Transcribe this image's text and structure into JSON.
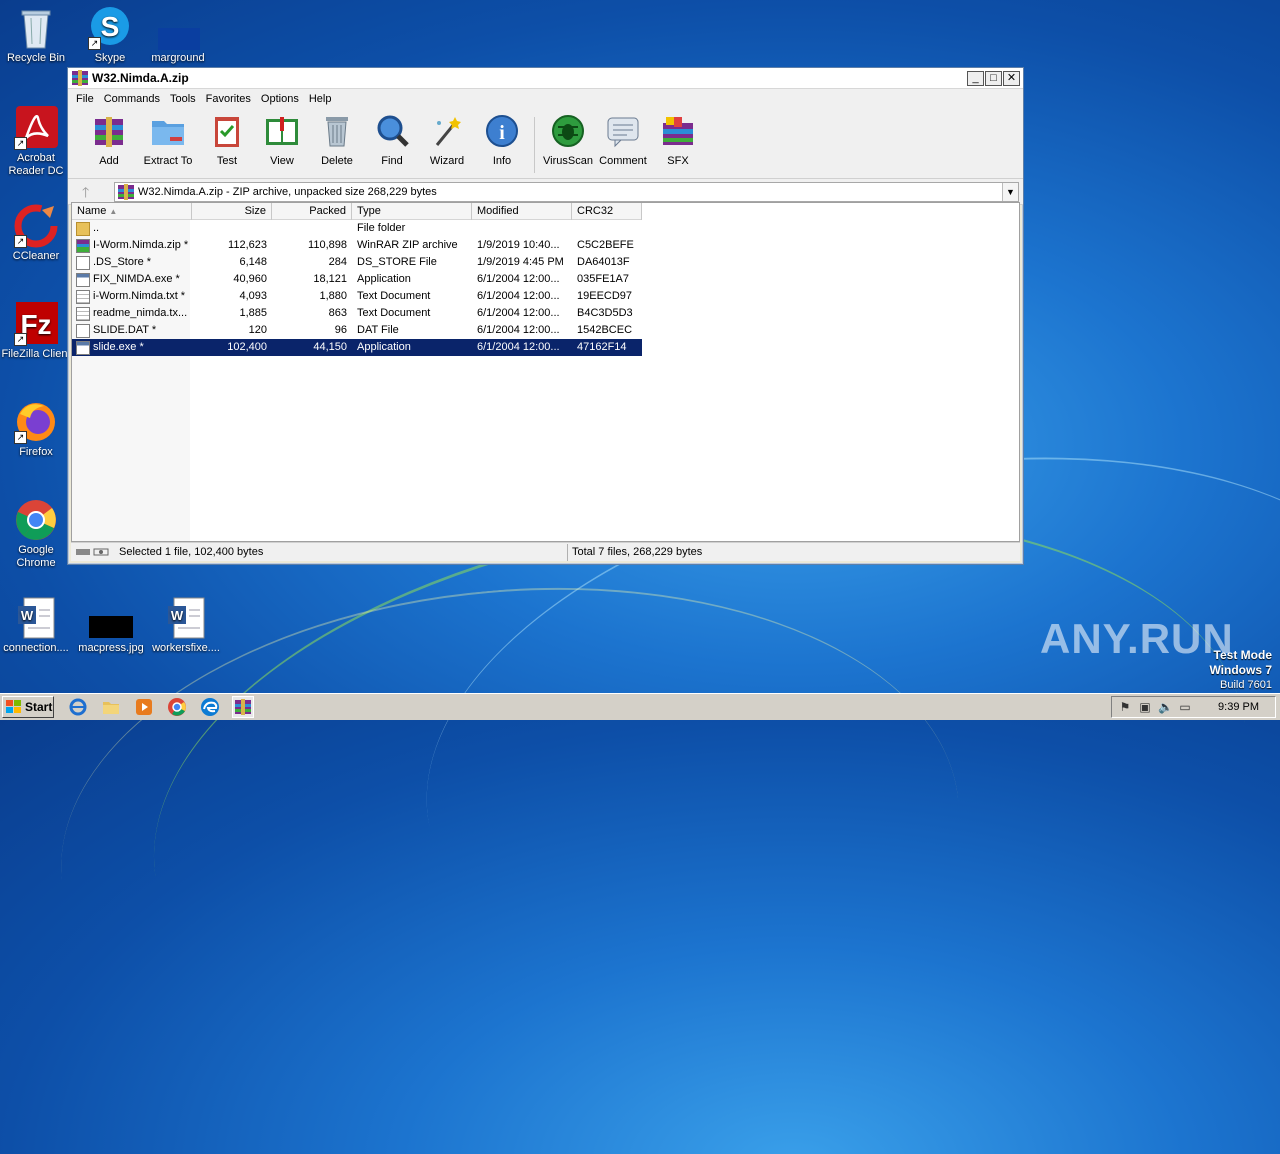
{
  "desktop": {
    "icons": [
      {
        "label": "Recycle Bin",
        "icon": "recycle-bin-icon"
      },
      {
        "label": "Skype",
        "icon": "skype-icon"
      },
      {
        "label": "marground",
        "icon": "image-file-icon"
      },
      {
        "label": "Acrobat Reader DC",
        "icon": "acrobat-icon"
      },
      {
        "label": "CCleaner",
        "icon": "ccleaner-icon"
      },
      {
        "label": "FileZilla Client",
        "icon": "filezilla-icon"
      },
      {
        "label": "Firefox",
        "icon": "firefox-icon"
      },
      {
        "label": "Google Chrome",
        "icon": "chrome-icon"
      },
      {
        "label": "connection....",
        "icon": "word-doc-icon"
      },
      {
        "label": "macpress.jpg",
        "icon": "image-file-icon"
      },
      {
        "label": "workersfixe....",
        "icon": "word-doc-icon"
      }
    ]
  },
  "window": {
    "title": "W32.Nimda.A.zip",
    "controls": {
      "minimize": "_",
      "maximize": "□",
      "close": "✕"
    },
    "menu": [
      "File",
      "Commands",
      "Tools",
      "Favorites",
      "Options",
      "Help"
    ],
    "toolbar": [
      {
        "label": "Add",
        "icon": "add-archive-icon"
      },
      {
        "label": "Extract To",
        "icon": "extract-folder-icon"
      },
      {
        "label": "Test",
        "icon": "test-clipboard-icon"
      },
      {
        "label": "View",
        "icon": "view-book-icon"
      },
      {
        "label": "Delete",
        "icon": "trash-icon"
      },
      {
        "label": "Find",
        "icon": "find-magnifier-icon"
      },
      {
        "label": "Wizard",
        "icon": "wizard-wand-icon"
      },
      {
        "label": "Info",
        "icon": "info-icon"
      },
      {
        "label": "VirusScan",
        "icon": "virus-scan-icon"
      },
      {
        "label": "Comment",
        "icon": "comment-icon"
      },
      {
        "label": "SFX",
        "icon": "sfx-icon"
      }
    ],
    "address": "W32.Nimda.A.zip - ZIP archive, unpacked size 268,229 bytes",
    "columns": [
      "Name",
      "Size",
      "Packed",
      "Type",
      "Modified",
      "CRC32"
    ],
    "files": [
      {
        "name": "..",
        "size": "",
        "packed": "",
        "type": "File folder",
        "modified": "",
        "crc": "",
        "icon": "folder-up-icon"
      },
      {
        "name": "I-Worm.Nimda.zip *",
        "size": "112,623",
        "packed": "110,898",
        "type": "WinRAR ZIP archive",
        "modified": "1/9/2019 10:40...",
        "crc": "C5C2BEFE",
        "icon": "zip-icon"
      },
      {
        "name": ".DS_Store *",
        "size": "6,148",
        "packed": "284",
        "type": "DS_STORE File",
        "modified": "1/9/2019 4:45 PM",
        "crc": "DA64013F",
        "icon": "file-icon"
      },
      {
        "name": "FIX_NIMDA.exe *",
        "size": "40,960",
        "packed": "18,121",
        "type": "Application",
        "modified": "6/1/2004 12:00...",
        "crc": "035FE1A7",
        "icon": "exe-icon"
      },
      {
        "name": "i-Worm.Nimda.txt *",
        "size": "4,093",
        "packed": "1,880",
        "type": "Text Document",
        "modified": "6/1/2004 12:00...",
        "crc": "19EECD97",
        "icon": "text-file-icon"
      },
      {
        "name": "readme_nimda.tx...",
        "size": "1,885",
        "packed": "863",
        "type": "Text Document",
        "modified": "6/1/2004 12:00...",
        "crc": "B4C3D5D3",
        "icon": "text-file-icon"
      },
      {
        "name": "SLIDE.DAT *",
        "size": "120",
        "packed": "96",
        "type": "DAT File",
        "modified": "6/1/2004 12:00...",
        "crc": "1542BCEC",
        "icon": "file-icon"
      },
      {
        "name": "slide.exe *",
        "size": "102,400",
        "packed": "44,150",
        "type": "Application",
        "modified": "6/1/2004 12:00...",
        "crc": "47162F14",
        "icon": "exe-icon",
        "selected": true
      }
    ],
    "status_left": "Selected 1 file, 102,400 bytes",
    "status_right": "Total 7 files, 268,229 bytes"
  },
  "taskbar": {
    "start": "Start",
    "clock": "9:39 PM"
  },
  "watermark": {
    "line1": "Test Mode",
    "line2": "Windows 7",
    "line3": "Build 7601",
    "brand": "ANY.RUN"
  }
}
